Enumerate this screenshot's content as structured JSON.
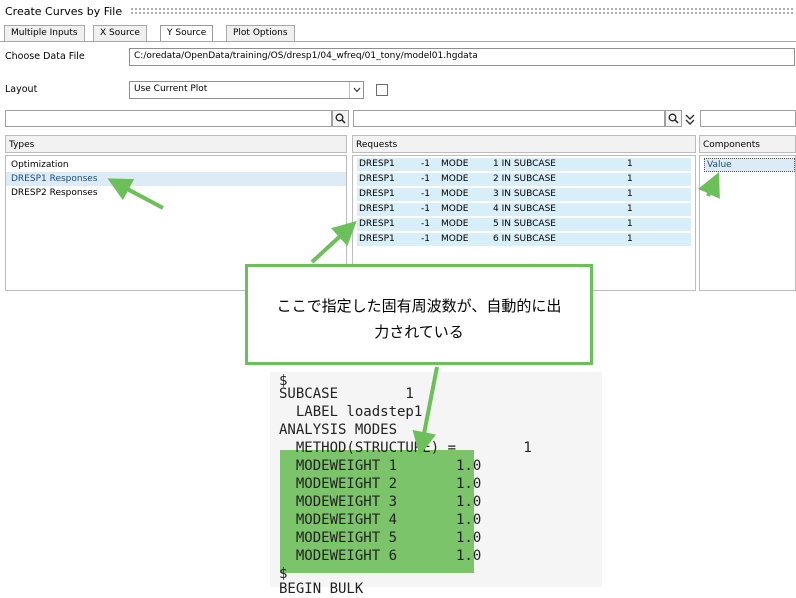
{
  "window": {
    "title": "Create Curves by File"
  },
  "tabs": [
    {
      "label": "Multiple Inputs",
      "active": false
    },
    {
      "label": "X Source",
      "active": false
    },
    {
      "label": "Y Source",
      "active": true
    },
    {
      "label": "Plot Options",
      "active": false
    }
  ],
  "form": {
    "data_file_label": "Choose Data File",
    "data_file_value": "C:/oredata/OpenData/training/OS/dresp1/04_wfreq/01_tony/model01.hgdata",
    "layout_label": "Layout",
    "layout_value": "Use Current Plot",
    "layout_checkbox_checked": false
  },
  "panels": {
    "types": {
      "header": "Types",
      "items": [
        {
          "label": "Optimization",
          "selected": false
        },
        {
          "label": "DRESP1 Responses",
          "selected": true
        },
        {
          "label": "DRESP2 Responses",
          "selected": false
        }
      ]
    },
    "requests": {
      "header": "Requests",
      "items": [
        {
          "c1": "DRESP1",
          "c2": "-1",
          "c3": "MODE",
          "c4": "1 IN SUBCASE",
          "c5": "1"
        },
        {
          "c1": "DRESP1",
          "c2": "-1",
          "c3": "MODE",
          "c4": "2 IN SUBCASE",
          "c5": "1"
        },
        {
          "c1": "DRESP1",
          "c2": "-1",
          "c3": "MODE",
          "c4": "3 IN SUBCASE",
          "c5": "1"
        },
        {
          "c1": "DRESP1",
          "c2": "-1",
          "c3": "MODE",
          "c4": "4 IN SUBCASE",
          "c5": "1"
        },
        {
          "c1": "DRESP1",
          "c2": "-1",
          "c3": "MODE",
          "c4": "5 IN SUBCASE",
          "c5": "1"
        },
        {
          "c1": "DRESP1",
          "c2": "-1",
          "c3": "MODE",
          "c4": "6 IN SUBCASE",
          "c5": "1"
        }
      ]
    },
    "components": {
      "header": "Components",
      "items": [
        {
          "label": "Value",
          "selected": true
        }
      ]
    }
  },
  "annotation": {
    "line1": "ここで指定した固有周波数が、自動的に出",
    "line2": "力されている"
  },
  "code_lines": [
    "$",
    "SUBCASE        1",
    "  LABEL loadstep1",
    "ANALYSIS MODES",
    "  METHOD(STRUCTURE) =        1",
    "  MODEWEIGHT 1       1.0",
    "  MODEWEIGHT 2       1.0",
    "  MODEWEIGHT 3       1.0",
    "  MODEWEIGHT 4       1.0",
    "  MODEWEIGHT 5       1.0",
    "  MODEWEIGHT 6       1.0",
    "$",
    "BEGIN BULK"
  ],
  "colors": {
    "annotation_green": "#6cc05a",
    "highlight_green": "#7cc46a",
    "selection_blue": "#dcebf5",
    "request_row_blue": "#d8eef8"
  },
  "icons": [
    "search-icon",
    "chevron-double-down-icon",
    "dropdown-arrow-icon"
  ]
}
